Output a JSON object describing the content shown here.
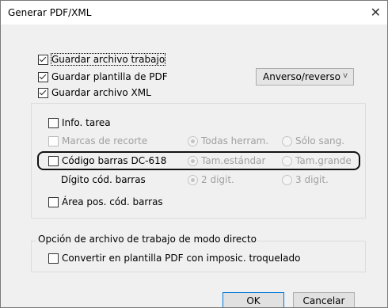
{
  "title": "Generar PDF/XML",
  "close_glyph": "✕",
  "top_options": {
    "save_work": {
      "label": "Guardar archivo trabajo",
      "checked": true
    },
    "save_pdf_template": {
      "label": "Guardar plantilla de PDF",
      "checked": true
    },
    "save_xml": {
      "label": "Guardar archivo XML",
      "checked": true
    }
  },
  "side_select": {
    "value": "Anverso/reverso",
    "chevron": "v"
  },
  "inner_group": {
    "job_info": {
      "label": "Info. tarea",
      "checked": false
    },
    "crop_marks": {
      "label": "Marcas de recorte",
      "checked": false,
      "radio_all": "Todas herram.",
      "radio_bleed": "Sólo sang."
    },
    "barcode": {
      "label": "Código barras DC-618",
      "checked": false,
      "radio_std": "Tam.estándar",
      "radio_large": "Tam.grande"
    },
    "barcode_digits": {
      "label": "Dígito cód. barras",
      "radio_2": "2 digit.",
      "radio_3": "3 digit."
    },
    "barcode_area": {
      "label": "Área pos. cód. barras",
      "checked": false
    }
  },
  "direct_mode": {
    "legend": "Opción de archivo de trabajo de modo directo",
    "convert": {
      "label": "Convertir en plantilla PDF con imposic. troquelado",
      "checked": false
    }
  },
  "buttons": {
    "ok": "OK",
    "cancel": "Cancelar"
  }
}
